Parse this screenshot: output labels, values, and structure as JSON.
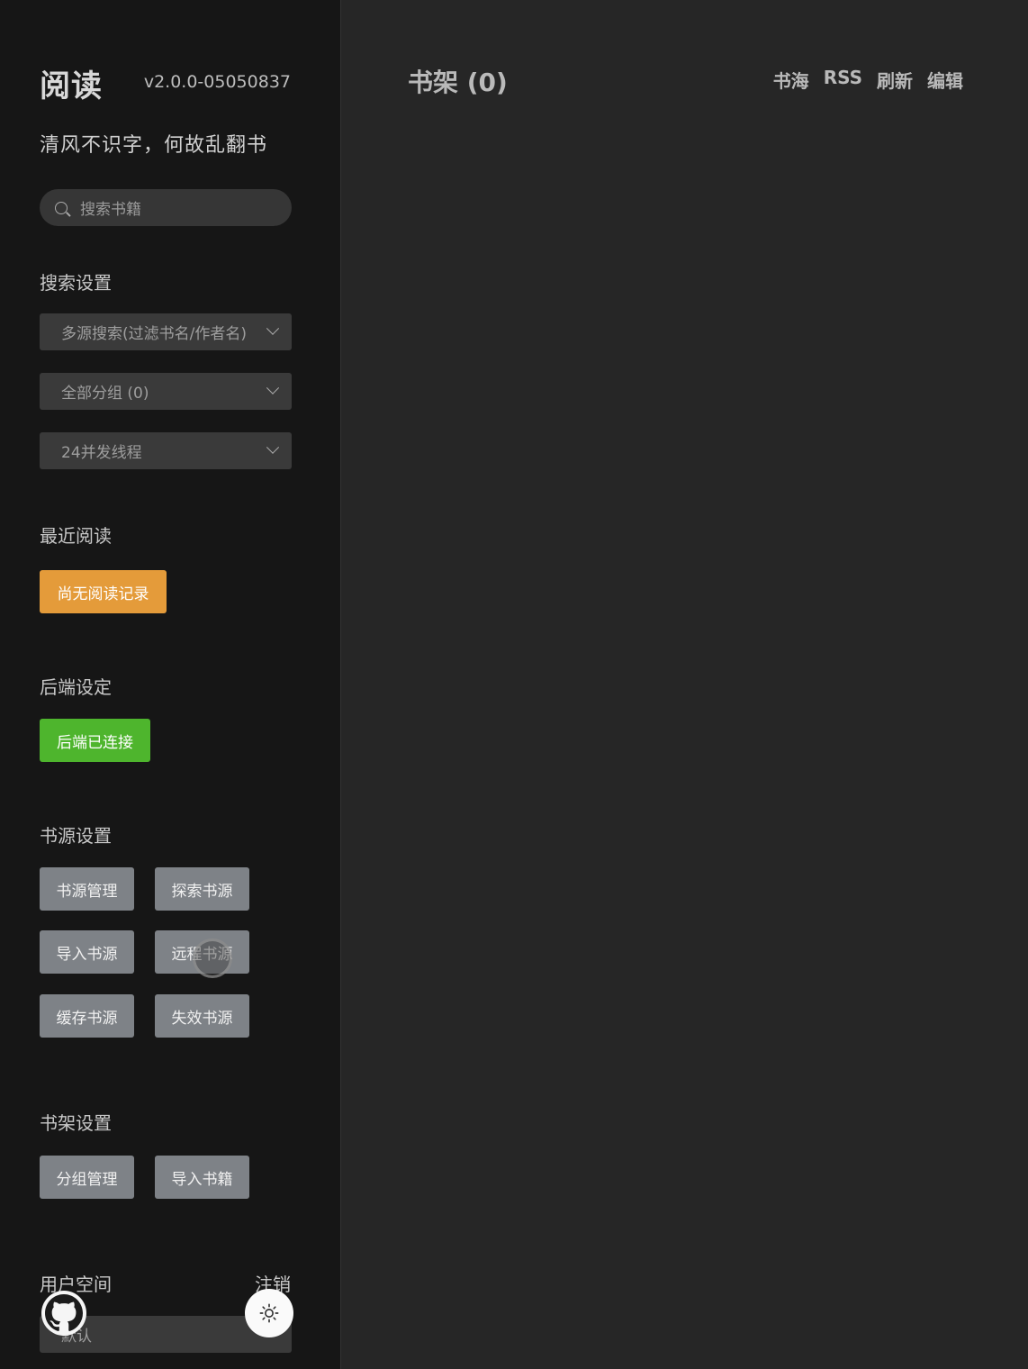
{
  "sidebar": {
    "title": "阅读",
    "version": "v2.0.0-05050837",
    "motto": "清风不识字，何故乱翻书",
    "search_placeholder": "搜索书籍",
    "search_settings": {
      "title": "搜索设置",
      "mode": "多源搜索(过滤书名/作者名)",
      "group": "全部分组 (0)",
      "threads": "24并发线程"
    },
    "recent": {
      "title": "最近阅读",
      "empty_label": "尚无阅读记录"
    },
    "backend": {
      "title": "后端设定",
      "status_label": "后端已连接"
    },
    "source_settings": {
      "title": "书源设置",
      "buttons": [
        "书源管理",
        "探索书源",
        "导入书源",
        "远程书源",
        "缓存书源",
        "失效书源"
      ]
    },
    "shelf_settings": {
      "title": "书架设置",
      "buttons": [
        "分组管理",
        "导入书籍"
      ]
    },
    "user_space": {
      "title": "用户空间",
      "logout": "注销",
      "current_user": "默认"
    },
    "icons": [
      "search-icon",
      "chevron-down-icon",
      "github-icon",
      "sun-icon"
    ]
  },
  "main": {
    "title": "书架 (0)",
    "nav": [
      "书海",
      "RSS",
      "刷新",
      "编辑"
    ]
  },
  "colors": {
    "sidebar_bg": "#161616",
    "main_bg": "#262626",
    "orange": "#e49b3a",
    "green": "#4eb52d",
    "grey_button": "#7e8287"
  }
}
